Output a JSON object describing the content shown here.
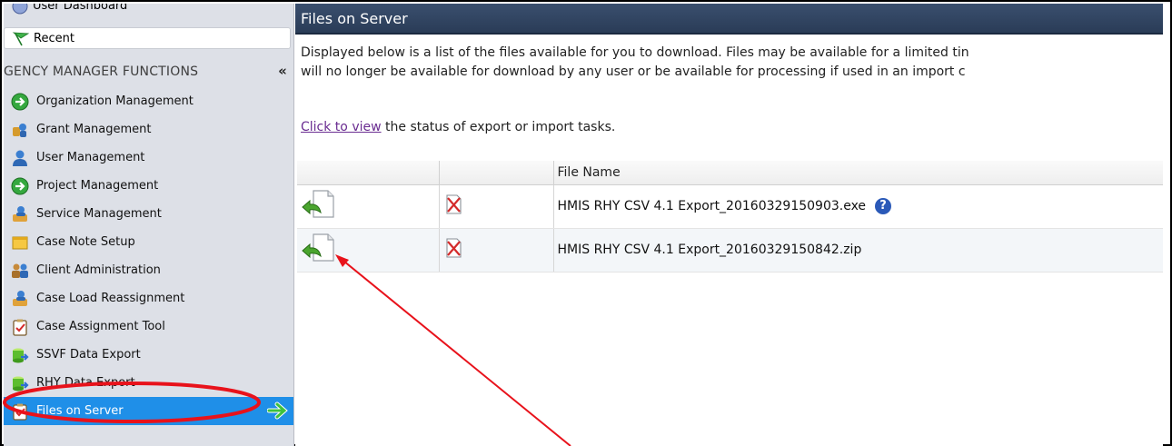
{
  "sidebar": {
    "top_items": {
      "dashboard": "User Dashboard",
      "recent": "Recent"
    },
    "section_title": "GENCY MANAGER FUNCTIONS",
    "collapse_glyph": "«",
    "items": [
      {
        "label": "Organization Management",
        "icon": "green-arrow-circle-icon"
      },
      {
        "label": "Grant Management",
        "icon": "grant-icon"
      },
      {
        "label": "User Management",
        "icon": "user-icon"
      },
      {
        "label": "Project Management",
        "icon": "green-arrow-circle-icon"
      },
      {
        "label": "Service Management",
        "icon": "service-icon"
      },
      {
        "label": "Case Note Setup",
        "icon": "note-icon"
      },
      {
        "label": "Client Administration",
        "icon": "client-group-icon"
      },
      {
        "label": "Case Load Reassignment",
        "icon": "service-icon"
      },
      {
        "label": "Case Assignment Tool",
        "icon": "clipboard-check-icon"
      },
      {
        "label": "SSVF Data Export",
        "icon": "database-export-icon"
      },
      {
        "label": "RHY Data Export",
        "icon": "database-export-icon"
      },
      {
        "label": "Files on Server",
        "icon": "clipboard-check-icon",
        "active": true
      }
    ]
  },
  "main": {
    "title": "Files on Server",
    "intro_line1": "Displayed below is a list of the files available for you to download. Files may be available for a limited tin",
    "intro_line2": "will no longer be available for download by any user or be available for processing if used in an import c",
    "status_link": "Click to view",
    "status_rest": " the status of export or import tasks.",
    "table": {
      "headers": [
        "",
        "",
        "File Name"
      ],
      "rows": [
        {
          "file_name": "HMIS RHY CSV 4.1 Export_20160329150903.exe",
          "has_help": true
        },
        {
          "file_name": "HMIS RHY CSV 4.1 Export_20160329150842.zip",
          "has_help": false
        }
      ],
      "help_glyph": "?"
    }
  },
  "colors": {
    "title_bar": "#2f4361",
    "active_item": "#1f8fe8",
    "annotation": "#e8121b",
    "link": "#6a2c91"
  }
}
